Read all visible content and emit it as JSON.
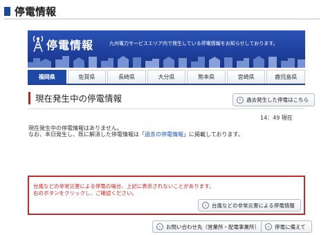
{
  "page": {
    "title": "停電情報"
  },
  "banner": {
    "title": "停電情報",
    "subtitle": "九州電力サービスエリア内で発生している停電情報をお知らせしております。"
  },
  "tabs": [
    {
      "label": "福岡県",
      "active": true
    },
    {
      "label": "佐賀県",
      "active": false
    },
    {
      "label": "長崎県",
      "active": false
    },
    {
      "label": "大分県",
      "active": false
    },
    {
      "label": "熊本県",
      "active": false
    },
    {
      "label": "宮崎県",
      "active": false
    },
    {
      "label": "鹿児島県",
      "active": false
    }
  ],
  "section": {
    "title": "現在発生中の停電情報",
    "past_button": "過去発生した停電はこちら",
    "time": "14：49 現在",
    "message_line1": "現在発生中の停電情報はありません。",
    "message_line2_before": "なお、本日発生し、既に解消した停電情報は「",
    "message_line2_link": "過去の停電情報",
    "message_line2_after": "」に掲載しております。"
  },
  "alert": {
    "line1": "台風などの非常災害による停電の場合、上記に表示されないことがあります。",
    "line2": "右のボタンをクリックし、ご確認ください。",
    "button": "台風などの非常災害による停電情報"
  },
  "footer": {
    "contact_button": "お問い合わせ先（営業所・配電事業所）",
    "prepare_button": "停電に備えて"
  },
  "icons": {
    "button_arrow": "circle-chevron-right",
    "banner_icon": "antenna-icon"
  },
  "colors": {
    "brand_blue": "#1e3f9a",
    "active_tab": "#1e49a6",
    "accent_red": "#c01f1f",
    "alert_text": "#cc2020",
    "link": "#1a53b8"
  }
}
